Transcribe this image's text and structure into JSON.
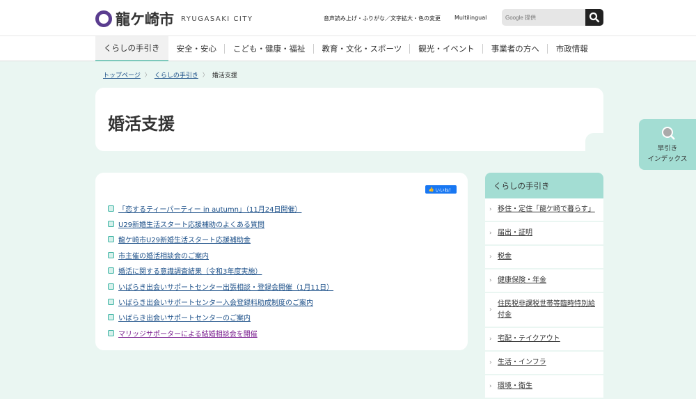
{
  "header": {
    "logo_name": "龍ケ崎市",
    "logo_en": "RYUGASAKI CITY",
    "accessibility_link": "音声読み上げ・ふりがな／文字拡大・色の変更",
    "multilingual_link": "Multilingual",
    "search_placeholder": "Google 提供"
  },
  "nav": [
    "くらしの手引き",
    "安全・安心",
    "こども・健康・福祉",
    "教育・文化・スポーツ",
    "観光・イベント",
    "事業者の方へ",
    "市政情報"
  ],
  "breadcrumb": {
    "items": [
      "トップページ",
      "くらしの手引き"
    ],
    "current": "婚活支援"
  },
  "page_title": "婚活支援",
  "like_button": "いいね！",
  "links": [
    "「恋するティーパーティー in autumn」（11月24日開催）",
    "U29新婚生活スタート応援補助のよくある質問",
    "龍ケ崎市U29新婚生活スタート応援補助金",
    "市主催の婚活相談会のご案内",
    "婚活に関する意識調査結果（令和3年度実施）",
    "いばらき出会いサポートセンター出張相談・登録会開催（1月11日）",
    "いばらき出会いサポートセンター入会登録料助成制度のご案内",
    "いばらき出会いサポートセンターのご案内",
    "マリッジサポーターによる結婚相談会を開催"
  ],
  "sidebar": {
    "title": "くらしの手引き",
    "items": [
      "移住・定住「龍ケ崎で暮らす」",
      "届出・証明",
      "税金",
      "健康保険・年金",
      "住民税非課税世帯等臨時特別給付金",
      "宅配・テイクアウト",
      "生活・インフラ",
      "環境・衛生"
    ]
  },
  "index_tab": {
    "line1": "早引き",
    "line2": "インデックス"
  },
  "colors": {
    "accent": "#a3ddd3",
    "background": "#eaf6f2",
    "link": "#1b4f88",
    "visited": "#7a1e8f",
    "logo": "#5a3d8f"
  }
}
